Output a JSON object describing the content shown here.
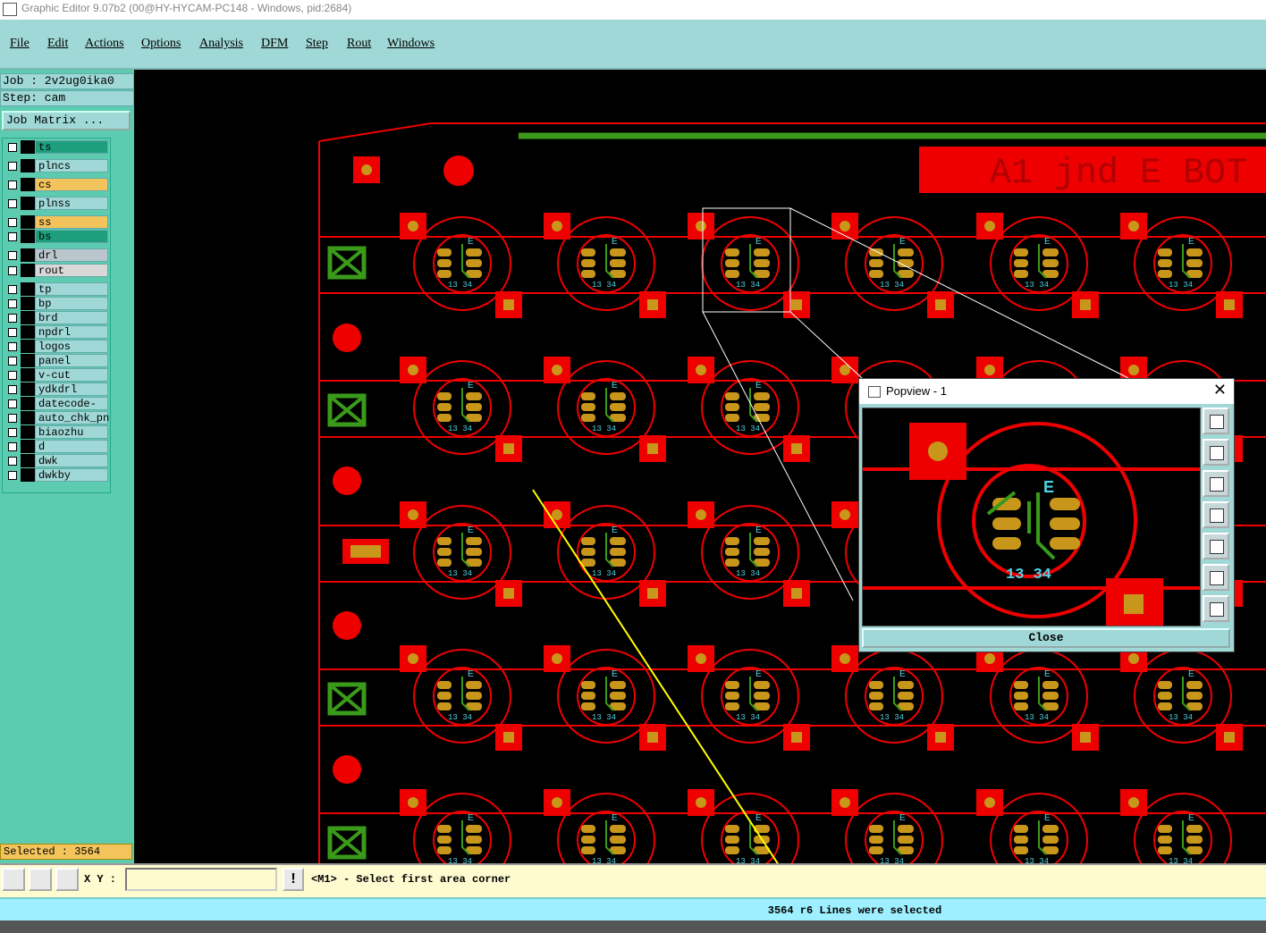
{
  "window": {
    "title": "Graphic Editor 9.07b2 (00@HY-HYCAM-PC148 - Windows, pid:2684)"
  },
  "menu": [
    "File",
    "Edit",
    "Actions",
    "Options",
    "Analysis",
    "DFM",
    "Step",
    "Rout",
    "Windows"
  ],
  "job": {
    "job_line": "Job : 2v2ug0ika0",
    "step_line": "Step: cam",
    "matrix_button": "Job Matrix ..."
  },
  "layers": [
    {
      "name": "ts",
      "color": "#1f9e7d"
    },
    {
      "name": "plncs",
      "color": "#9fd8d6"
    },
    {
      "name": "cs",
      "color": "#f3c45c"
    },
    {
      "name": "plnss",
      "color": "#9fd8d6"
    },
    {
      "name": "ss",
      "color": "#f3c45c"
    },
    {
      "name": "bs",
      "color": "#1f9e7d"
    },
    {
      "name": "drl",
      "color": "#b9c6cc"
    },
    {
      "name": "rout",
      "color": "#d8d8d8"
    },
    {
      "name": "tp",
      "color": "#9fd8d6"
    },
    {
      "name": "bp",
      "color": "#9fd8d6"
    },
    {
      "name": "brd",
      "color": "#9fd8d6"
    },
    {
      "name": "npdrl",
      "color": "#9fd8d6"
    },
    {
      "name": "logos",
      "color": "#9fd8d6"
    },
    {
      "name": "panel",
      "color": "#9fd8d6"
    },
    {
      "name": "v-cut",
      "color": "#9fd8d6"
    },
    {
      "name": "ydkdrl",
      "color": "#9fd8d6"
    },
    {
      "name": "datecode-ts",
      "color": "#9fd8d6"
    },
    {
      "name": "auto_chk_pn",
      "color": "#9fd8d6"
    },
    {
      "name": "biaozhu",
      "color": "#9fd8d6"
    },
    {
      "name": "d",
      "color": "#9fd8d6"
    },
    {
      "name": "dwk",
      "color": "#9fd8d6"
    },
    {
      "name": "dwkby",
      "color": "#9fd8d6"
    }
  ],
  "selected": "Selected : 3564",
  "canvas": {
    "board_text": "A1 jnd E BOT"
  },
  "popview": {
    "title": "Popview - 1",
    "close_label": "Close"
  },
  "bottom": {
    "xy_label": "X Y :",
    "xy_value": "",
    "prompt": "<M1> - Select first area corner",
    "status": "3564 r6 Lines were selected"
  }
}
